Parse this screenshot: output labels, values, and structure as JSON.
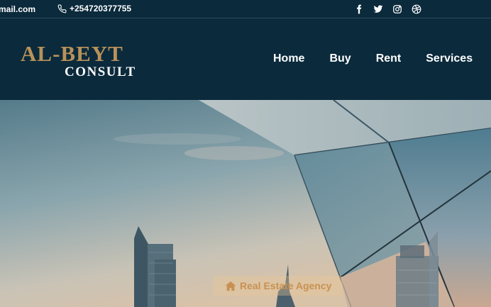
{
  "topbar": {
    "email": "mail.com",
    "phone": "+254720377755",
    "phone_icon": "phone-icon",
    "socials": [
      "facebook-icon",
      "twitter-icon",
      "instagram-icon",
      "dribbble-icon"
    ]
  },
  "header": {
    "logo_line1": "AL-BEYT",
    "logo_line2": "CONSULT",
    "nav": [
      {
        "label": "Home"
      },
      {
        "label": "Buy"
      },
      {
        "label": "Rent"
      },
      {
        "label": "Services"
      }
    ]
  },
  "hero": {
    "badge_text": "Real Estate Agency",
    "badge_icon": "home-icon"
  },
  "colors": {
    "navy": "#0b2a3c",
    "gold": "#b8925a",
    "accent": "#c89152"
  }
}
